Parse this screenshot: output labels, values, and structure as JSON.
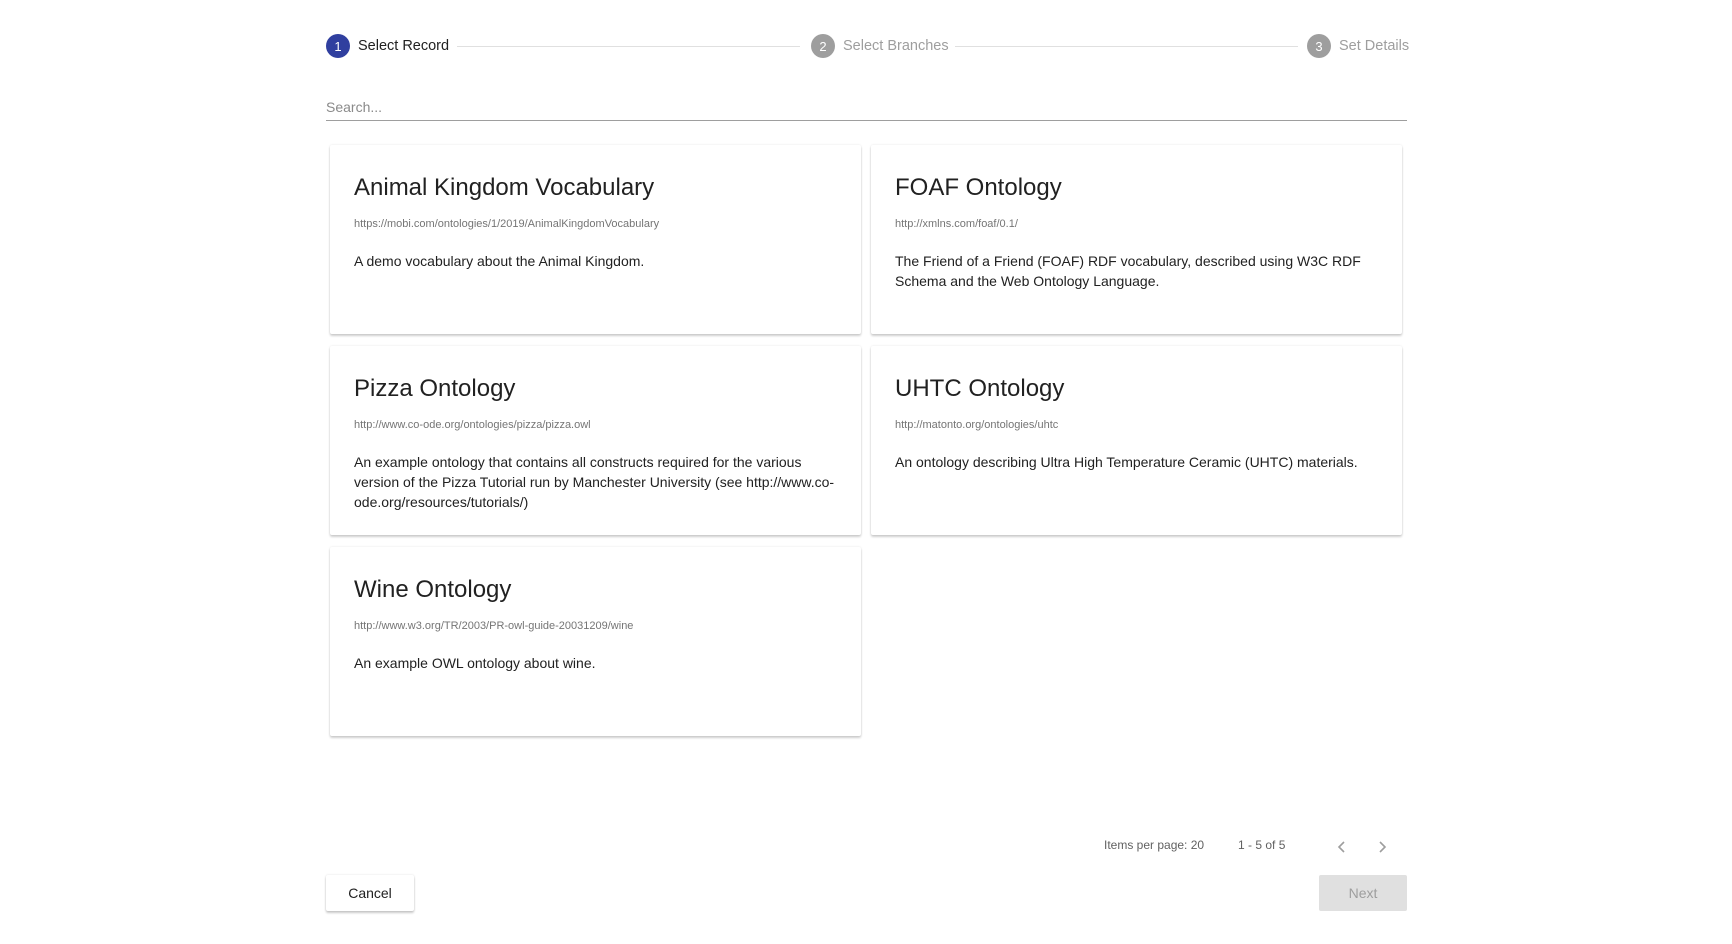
{
  "stepper": {
    "steps": [
      {
        "number": "1",
        "label": "Select Record",
        "state": "active"
      },
      {
        "number": "2",
        "label": "Select Branches",
        "state": "inactive"
      },
      {
        "number": "3",
        "label": "Set Details",
        "state": "inactive"
      }
    ]
  },
  "search": {
    "placeholder": "Search...",
    "value": ""
  },
  "records": [
    {
      "title": "Animal Kingdom Vocabulary",
      "iri": "https://mobi.com/ontologies/1/2019/AnimalKingdomVocabulary",
      "description": "A demo vocabulary about the Animal Kingdom."
    },
    {
      "title": "FOAF Ontology",
      "iri": "http://xmlns.com/foaf/0.1/",
      "description": "The Friend of a Friend (FOAF) RDF vocabulary, described using W3C RDF Schema and the Web Ontology Language."
    },
    {
      "title": "Pizza Ontology",
      "iri": "http://www.co-ode.org/ontologies/pizza/pizza.owl",
      "description": "An example ontology that contains all constructs required for the various version of the Pizza Tutorial run by Manchester University (see http://www.co-ode.org/resources/tutorials/)"
    },
    {
      "title": "UHTC Ontology",
      "iri": "http://matonto.org/ontologies/uhtc",
      "description": "An ontology describing Ultra High Temperature Ceramic (UHTC) materials."
    },
    {
      "title": "Wine Ontology",
      "iri": "http://www.w3.org/TR/2003/PR-owl-guide-20031209/wine",
      "description": "An example OWL ontology about wine."
    }
  ],
  "paginator": {
    "items_per_page_label": "Items per page: 20",
    "range_label": "1 - 5 of 5",
    "prev_icon": "chevron-left-icon",
    "next_icon": "chevron-right-icon"
  },
  "footer": {
    "cancel_label": "Cancel",
    "next_label": "Next"
  },
  "colors": {
    "accent": "#303f9f",
    "inactive": "#9e9e9e"
  }
}
